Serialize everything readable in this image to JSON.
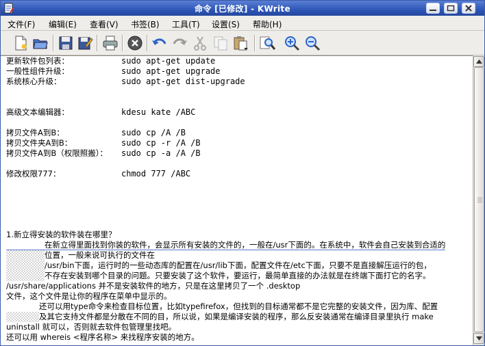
{
  "window": {
    "title": "命令 [已修改] - KWrite"
  },
  "menu": [
    "文件(F)",
    "编辑(E)",
    "查看(V)",
    "书签(B)",
    "工具(T)",
    "设置(S)",
    "帮助(H)"
  ],
  "toolbar_icons": [
    "new-file-icon",
    "open-folder-icon",
    "save-icon",
    "save-as-icon",
    "print-icon",
    "stop-icon",
    "undo-icon",
    "redo-icon",
    "cut-icon",
    "copy-icon",
    "paste-icon",
    "find-icon",
    "zoom-in-icon",
    "zoom-out-icon"
  ],
  "colors": {
    "titlebar": "#2e57b8",
    "selection_hatch": "#d4d4d4",
    "editor_bg": "#ffffff"
  },
  "editor": {
    "lines": [
      {
        "label": "更新软件包列表：",
        "cmd": "sudo apt-get update"
      },
      {
        "label": "一般性组件升级：",
        "cmd": "sudo apt-get upgrade"
      },
      {
        "label": "系统核心升级：",
        "cmd": "sudo apt-get dist-upgrade"
      },
      {
        "label": "高级文本编辑器：",
        "cmd": "kdesu kate /ABC"
      },
      {
        "label": "拷贝文件A到B：",
        "cmd": "sudo cp /A /B"
      },
      {
        "label": "拷贝文件夹A到B：",
        "cmd": "sudo cp -r /A /B"
      },
      {
        "label": "拷贝文件A到B（权限照搬）：",
        "cmd": "sudo cp -a /A /B"
      },
      {
        "label": "修改权限777：",
        "cmd": "chmod 777 /ABC"
      }
    ],
    "question": "1.新立得安装的软件装在哪里？",
    "para1": [
      "在新立得里面找到你装的软件，会显示所有安装的文件的，一般在/usr下面的。在系统中，软件会自己安装到合适的",
      "位置，一般来说可执行的文件在",
      "/usr/bin下面，运行时的一些动态库的配置在/usr/lib下面，配置文件在/etc下面，只要不是直接解压运行的包，",
      "不存在安装到哪个目录的问题。只要安装了这个软件，要运行，最简单直接的办法就是在终端下面打它的名字。",
      "/usr/share/applications 并不是安装软件的地方，只是在这里拷贝了一个 .desktop",
      "文件，这个文件是让你的程序在菜单中显示的。"
    ],
    "para2": [
      "还可以用type命令来检查目标位置，比如typefirefox，但找到的目标通常都不是它完整的安装文件，因为库、配置",
      "及其它支持文件都是分散在不同的目，所以说，如果是编译安装的程序，那么反安装通常在编译目录里执行 make",
      "uninstall 就可以，否则就去软件包管理里找吧。",
      "还可以用 whereis <程序名称> 来找程序安装的地方。"
    ]
  }
}
